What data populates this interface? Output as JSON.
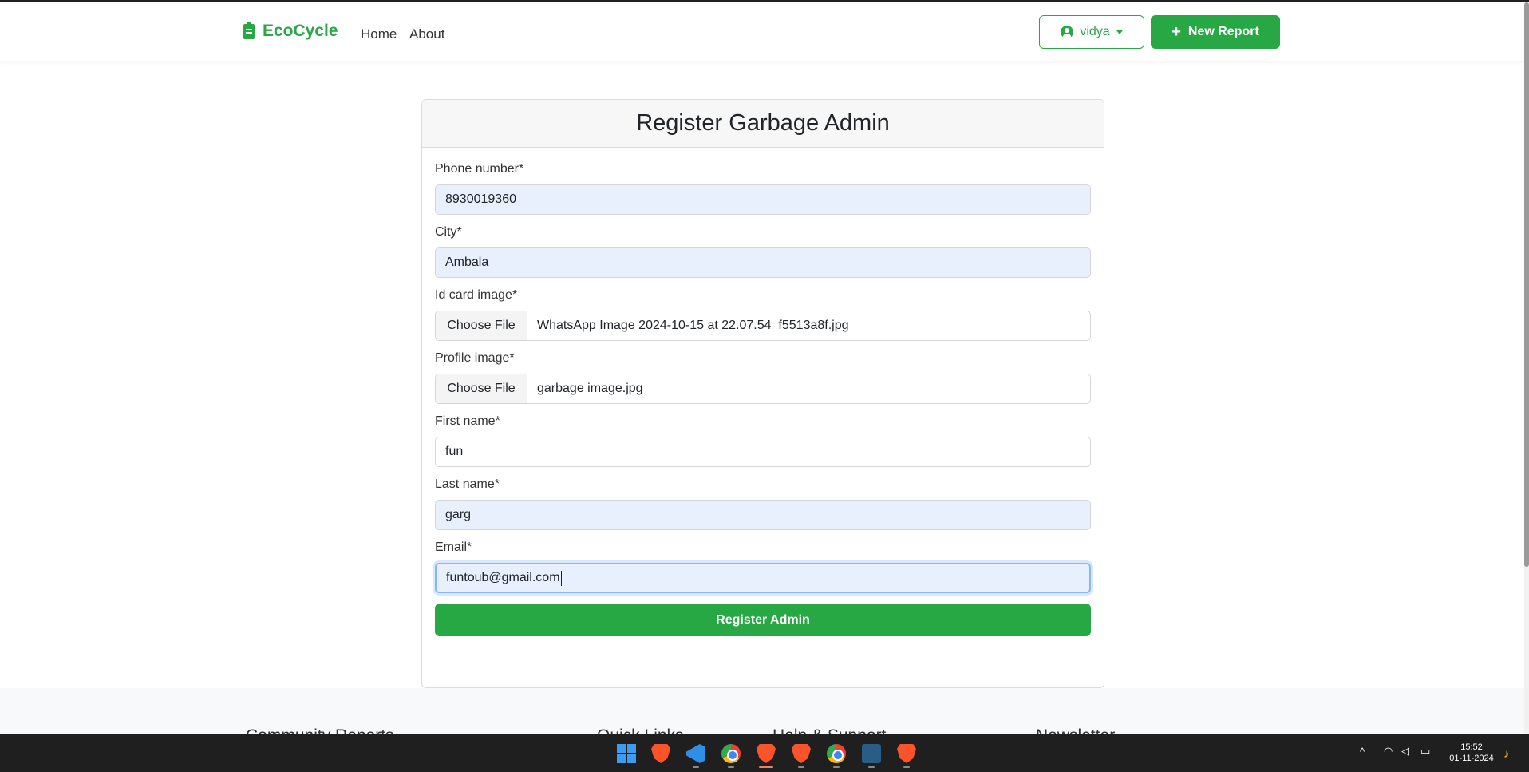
{
  "navbar": {
    "brand": "EcoCycle",
    "links": [
      "Home",
      "About"
    ],
    "user": "vidya",
    "new_report": "New Report"
  },
  "form": {
    "title": "Register Garbage Admin",
    "phone": {
      "label": "Phone number*",
      "value": "8930019360"
    },
    "city": {
      "label": "City*",
      "value": "Ambala"
    },
    "id_card": {
      "label": "Id card image*",
      "button": "Choose File",
      "file": "WhatsApp Image 2024-10-15 at 22.07.54_f5513a8f.jpg"
    },
    "profile": {
      "label": "Profile image*",
      "button": "Choose File",
      "file": "garbage image.jpg"
    },
    "first_name": {
      "label": "First name*",
      "value": "fun"
    },
    "last_name": {
      "label": "Last name*",
      "value": "garg"
    },
    "email": {
      "label": "Email*",
      "value": "funtoub@gmail.com"
    },
    "submit": "Register Admin"
  },
  "footer": {
    "headings": [
      "Community Reports",
      "Quick Links",
      "Help & Support",
      "Newsletter"
    ]
  },
  "taskbar": {
    "apps": [
      "windows-start",
      "brave",
      "vscode",
      "chrome",
      "brave-active",
      "brave",
      "chrome",
      "sql-developer",
      "brave-dev"
    ],
    "time": "15:52",
    "date": "01-11-2024"
  },
  "colors": {
    "accent": "#28a745",
    "autofill": "#e8f0fe",
    "taskbar": "#1f1f1f"
  }
}
